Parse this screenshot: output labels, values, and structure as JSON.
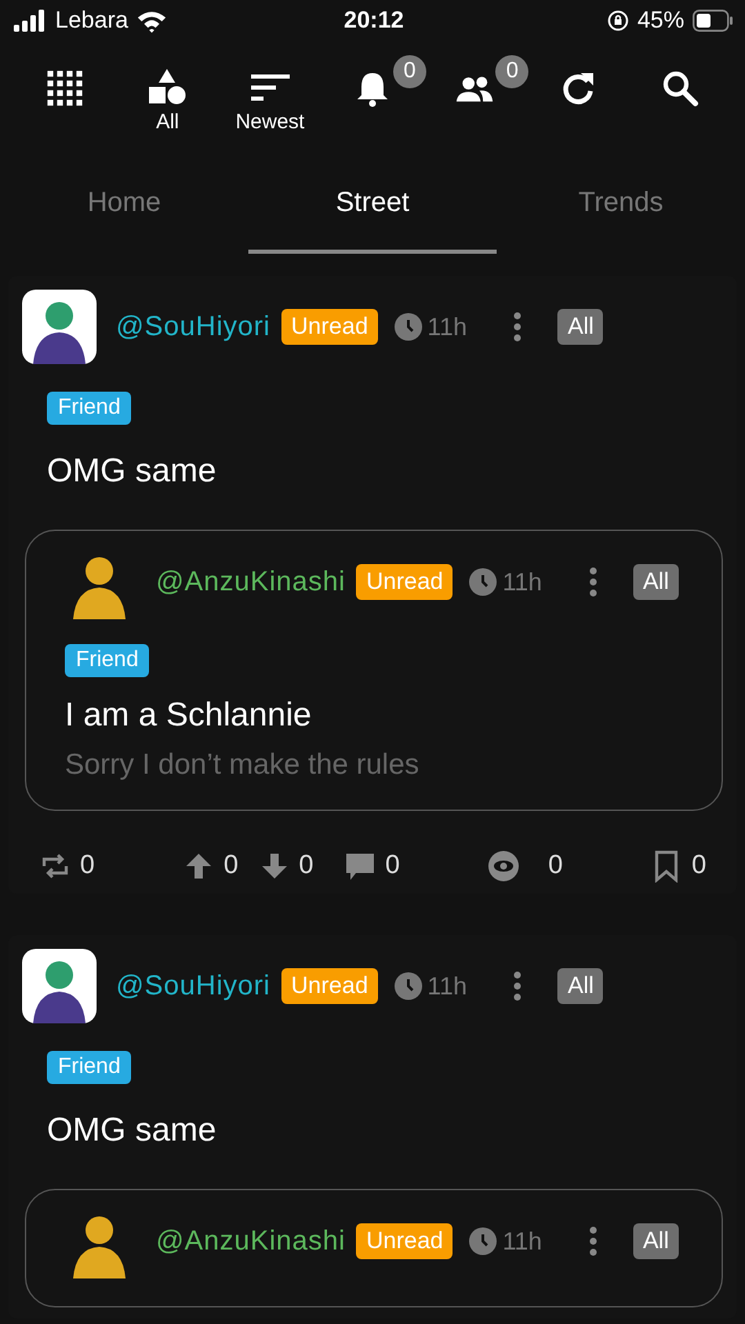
{
  "status_bar": {
    "carrier": "Lebara",
    "time": "20:12",
    "battery": "45%"
  },
  "toolbar": [
    {
      "kind": "grid"
    },
    {
      "kind": "shapes",
      "label": "All"
    },
    {
      "kind": "sort",
      "label": "Newest"
    },
    {
      "kind": "bell",
      "badge": "0"
    },
    {
      "kind": "people",
      "badge": "0"
    },
    {
      "kind": "refresh"
    },
    {
      "kind": "search"
    }
  ],
  "tabs": [
    {
      "label": "Home",
      "selected": false
    },
    {
      "label": "Street",
      "selected": true
    },
    {
      "label": "Trends",
      "selected": false
    }
  ],
  "posts": [
    {
      "author": "@SouHiyori",
      "color": "#22b5c9",
      "status": "Unread",
      "time": "11h",
      "scope": "All",
      "tag": "Friend",
      "text": "OMG same",
      "quote": {
        "author": "@AnzuKinashi",
        "color": "#5cb85c",
        "status": "Unread",
        "time": "11h",
        "scope": "All",
        "tag": "Friend",
        "title": "I am a Schlannie",
        "body": "Sorry I don’t make the rules"
      },
      "actions": [
        {
          "kind": "repost",
          "count": "0"
        },
        {
          "kind": "upvote",
          "count": "0"
        },
        {
          "kind": "downvote",
          "count": "0"
        },
        {
          "kind": "comment",
          "count": "0"
        },
        {
          "kind": "views",
          "count": "0"
        },
        {
          "kind": "bookmark",
          "count": "0"
        }
      ]
    },
    {
      "author": "@SouHiyori",
      "color": "#22b5c9",
      "status": "Unread",
      "time": "11h",
      "scope": "All",
      "tag": "Friend",
      "text": "OMG same",
      "quote": {
        "author": "@AnzuKinashi",
        "color": "#5cb85c",
        "status": "Unread",
        "time": "11h",
        "scope": "All"
      }
    }
  ]
}
